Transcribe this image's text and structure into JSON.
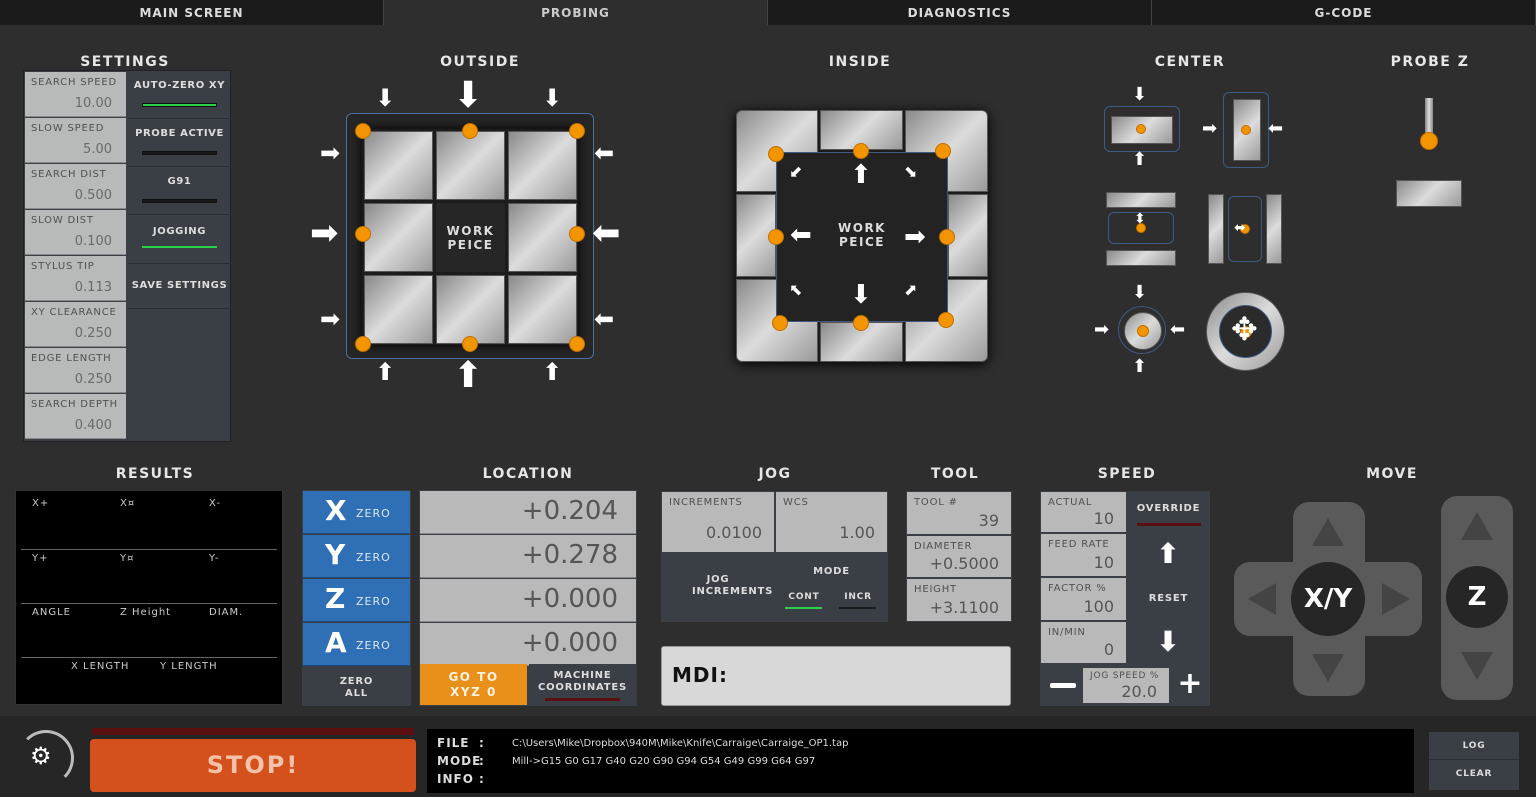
{
  "tabs": [
    "MAIN SCREEN",
    "PROBING",
    "DIAGNOSTICS",
    "G-CODE"
  ],
  "sections": {
    "settings": "SETTINGS",
    "outside": "OUTSIDE",
    "inside": "INSIDE",
    "center": "CENTER",
    "probe_z": "PROBE Z",
    "results": "RESULTS",
    "location": "LOCATION",
    "jog": "JOG",
    "tool": "TOOL",
    "speed": "SPEED",
    "move": "MOVE"
  },
  "settings": [
    {
      "label": "SEARCH SPEED",
      "value": "10.00"
    },
    {
      "label": "SLOW SPEED",
      "value": "5.00"
    },
    {
      "label": "SEARCH DIST",
      "value": "0.500"
    },
    {
      "label": "SLOW DIST",
      "value": "0.100"
    },
    {
      "label": "STYLUS TIP",
      "value": "0.113"
    },
    {
      "label": "XY CLEARANCE",
      "value": "0.250"
    },
    {
      "label": "EDGE LENGTH",
      "value": "0.250"
    },
    {
      "label": "SEARCH DEPTH",
      "value": "0.400"
    }
  ],
  "settings_buttons": [
    "AUTO-ZERO XY",
    "PROBE ACTIVE",
    "G91",
    "JOGGING",
    "SAVE SETTINGS"
  ],
  "workpiece": {
    "line1": "WORK",
    "line2": "PEICE"
  },
  "results": {
    "xp": "X+",
    "xc": "X¤",
    "xm": "X-",
    "yp": "Y+",
    "yc": "Y¤",
    "ym": "Y-",
    "angle": "ANGLE",
    "zheight": "Z Height",
    "diam": "DIAM.",
    "xlen": "X LENGTH",
    "ylen": "Y LENGTH"
  },
  "location": {
    "axes": [
      {
        "axis": "X",
        "btn": "ZERO",
        "value": "+0.204"
      },
      {
        "axis": "Y",
        "btn": "ZERO",
        "value": "+0.278"
      },
      {
        "axis": "Z",
        "btn": "ZERO",
        "value": "+0.000"
      },
      {
        "axis": "A",
        "btn": "ZERO",
        "value": "+0.000"
      }
    ],
    "zero_all": "ZERO ALL",
    "goto": "GO TO XYZ 0",
    "machine": "MACHINE COORDINATES"
  },
  "jog": {
    "increments_label": "INCREMENTS",
    "increments_value": "0.0100",
    "wcs_label": "WCS",
    "wcs_value": "1.00",
    "jog_increments": "JOG INCREMENTS",
    "mode": "MODE",
    "cont": "CONT",
    "incr": "INCR"
  },
  "tool": {
    "tool_label": "TOOL #",
    "tool_value": "39",
    "diam_label": "DIAMETER",
    "diam_value": "+0.5000",
    "height_label": "HEIGHT",
    "height_value": "+3.1100"
  },
  "speed": {
    "actual_label": "ACTUAL",
    "actual_value": "10",
    "feed_label": "FEED RATE",
    "feed_value": "10",
    "factor_label": "FACTOR %",
    "factor_value": "100",
    "inmin_label": "IN/MIN",
    "inmin_value": "0",
    "override": "OVERRIDE",
    "reset": "RESET",
    "jog_speed_label": "JOG SPEED %",
    "jog_speed_value": "20.0"
  },
  "move": {
    "xy": "X/Y",
    "z": "Z"
  },
  "mdi": "MDI:",
  "stop": "STOP!",
  "info": {
    "file_k": "FILE",
    "mode_k": "MODE",
    "info_k": "INFO",
    "colon": ":",
    "file_v": "C:\\Users\\Mike\\Dropbox\\940M\\Mike\\Knife\\Carraige\\Carraige_OP1.tap",
    "mode_v": "Mill->G15  G0 G17 G40 G20 G90 G94 G54 G49 G99 G64 G97",
    "info_v": ""
  },
  "log": "LOG",
  "clear": "CLEAR",
  "colors": {
    "accent_orange": "#f39500",
    "stop_red": "#d4501d",
    "zero_blue": "#2f6fb5",
    "led_green": "#2bd14a"
  }
}
